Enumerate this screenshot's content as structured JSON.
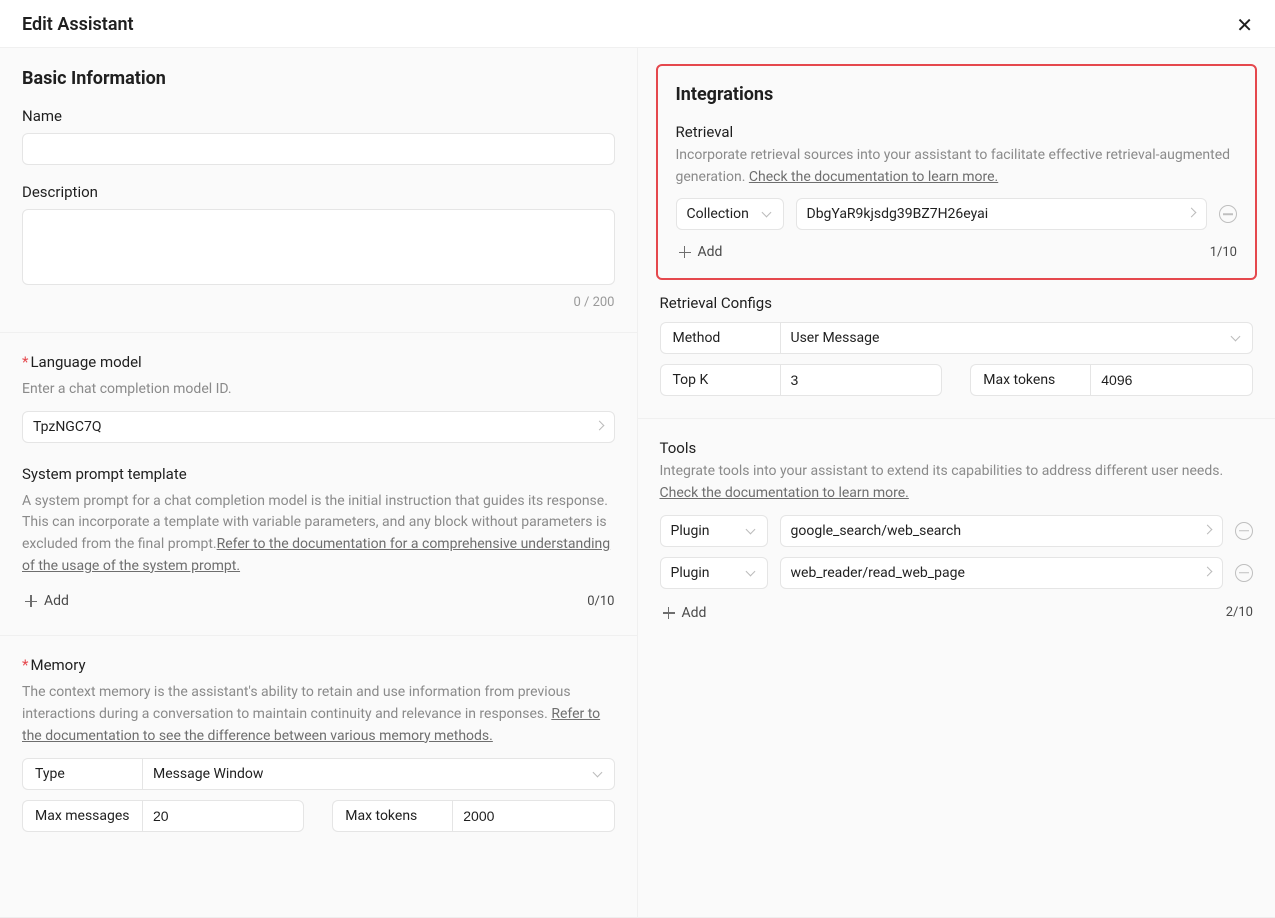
{
  "header": {
    "title": "Edit Assistant"
  },
  "basic": {
    "title": "Basic Information",
    "name_label": "Name",
    "name_value": "",
    "desc_label": "Description",
    "desc_value": "",
    "desc_counter": "0 / 200"
  },
  "model": {
    "label": "Language model",
    "hint": "Enter a chat completion model ID.",
    "value": "TpzNGC7Q",
    "sys_label": "System prompt template",
    "sys_hint_a": "A system prompt for a chat completion model is the initial instruction that guides its response. This can incorporate a template with variable parameters, and any block without parameters is excluded from the final prompt.",
    "sys_hint_link": "Refer to the documentation for a comprehensive understanding of the usage of the system prompt.",
    "add_label": "Add",
    "count": "0/10"
  },
  "memory": {
    "label": "Memory",
    "hint_a": "The context memory is the assistant's ability to retain and use information from previous interactions during a conversation to maintain continuity and relevance in responses. ",
    "hint_link": "Refer to the documentation to see the difference between various memory methods.",
    "type_label": "Type",
    "type_value": "Message Window",
    "max_messages_label": "Max messages",
    "max_messages_value": "20",
    "max_tokens_label": "Max tokens",
    "max_tokens_value": "2000"
  },
  "integrations": {
    "title": "Integrations",
    "retrieval": {
      "label": "Retrieval",
      "hint_a": "Incorporate retrieval sources into your assistant to facilitate effective retrieval-augmented generation. ",
      "hint_link": "Check the documentation to learn more.",
      "rows": [
        {
          "type": "Collection",
          "value": "DbgYaR9kjsdg39BZ7H26eyai"
        }
      ],
      "add_label": "Add",
      "count": "1/10"
    },
    "retrieval_configs": {
      "label": "Retrieval Configs",
      "method_label": "Method",
      "method_value": "User Message",
      "topk_label": "Top K",
      "topk_value": "3",
      "max_tokens_label": "Max tokens",
      "max_tokens_value": "4096"
    },
    "tools": {
      "label": "Tools",
      "hint_a": "Integrate tools into your assistant to extend its capabilities to address different user needs. ",
      "hint_link": "Check the documentation to learn more.",
      "rows": [
        {
          "type": "Plugin",
          "value": "google_search/web_search"
        },
        {
          "type": "Plugin",
          "value": "web_reader/read_web_page"
        }
      ],
      "add_label": "Add",
      "count": "2/10"
    }
  }
}
